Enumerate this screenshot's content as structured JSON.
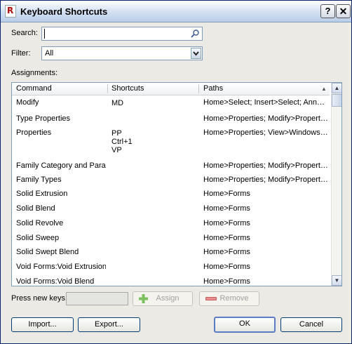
{
  "window": {
    "title": "Keyboard Shortcuts",
    "app_icon": "R",
    "help_label": "?",
    "close_label": "✕"
  },
  "search": {
    "label": "Search:",
    "value": ""
  },
  "filter": {
    "label": "Filter:",
    "value": "All"
  },
  "assignments": {
    "label": "Assignments:",
    "columns": [
      "Command",
      "Shortcuts",
      "Paths"
    ],
    "rows": [
      {
        "command": "Modify",
        "shortcuts": "MD",
        "paths": "Home>Select; Insert>Select; Annotate>Select"
      },
      {
        "command": "Type Properties",
        "shortcuts": "",
        "paths": "Home>Properties; Modify>Properties"
      },
      {
        "command": "Properties",
        "shortcuts": "PP\nCtrl+1\nVP",
        "paths": "Home>Properties; View>Windows; Modify>Properties"
      },
      {
        "command": "Family Category and Parameters",
        "shortcuts": "",
        "paths": "Home>Properties; Modify>Properties"
      },
      {
        "command": "Family Types",
        "shortcuts": "",
        "paths": "Home>Properties; Modify>Properties"
      },
      {
        "command": "Solid Extrusion",
        "shortcuts": "",
        "paths": "Home>Forms"
      },
      {
        "command": "Solid Blend",
        "shortcuts": "",
        "paths": "Home>Forms"
      },
      {
        "command": "Solid Revolve",
        "shortcuts": "",
        "paths": "Home>Forms"
      },
      {
        "command": "Solid Sweep",
        "shortcuts": "",
        "paths": "Home>Forms"
      },
      {
        "command": "Solid Swept Blend",
        "shortcuts": "",
        "paths": "Home>Forms"
      },
      {
        "command": "Void Forms:Void Extrusion",
        "shortcuts": "",
        "paths": "Home>Forms"
      },
      {
        "command": "Void Forms:Void Blend",
        "shortcuts": "",
        "paths": "Home>Forms"
      }
    ],
    "display": {
      "r0c1": "Modify",
      "r0c2": "MD",
      "r0c3": "Home>Select; Insert>Select; Annot...",
      "r1c1": "Type Properties",
      "r1c3": "Home>Properties; Modify>Properties",
      "r2c1": "Properties",
      "r2c2a": "PP",
      "r2c2b": "Ctrl+1",
      "r2c2c": "VP",
      "r2c3": "Home>Properties; View>Windows;...",
      "r3c1": "Family Category and Para...",
      "r3c3": "Home>Properties; Modify>Properties",
      "r4c1": "Family Types",
      "r4c3": "Home>Properties; Modify>Properties",
      "r5c1": "Solid Extrusion",
      "r5c3": "Home>Forms",
      "r6c1": "Solid Blend",
      "r6c3": "Home>Forms",
      "r7c1": "Solid Revolve",
      "r7c3": "Home>Forms",
      "r8c1": "Solid Sweep",
      "r8c3": "Home>Forms",
      "r9c1": "Solid Swept Blend",
      "r9c3": "Home>Forms",
      "r10c1": "Void Forms:Void Extrusion",
      "r10c3": "Home>Forms",
      "r11c1": "Void Forms:Void Blend",
      "r11c3": "Home>Forms"
    }
  },
  "press_new_keys": {
    "label": "Press new keys:",
    "value": ""
  },
  "buttons": {
    "assign": "Assign",
    "remove": "Remove",
    "import": "Import...",
    "export": "Export...",
    "ok": "OK",
    "cancel": "Cancel"
  },
  "colors": {
    "assign_icon": "#7cc060",
    "remove_icon": "#e89090"
  }
}
